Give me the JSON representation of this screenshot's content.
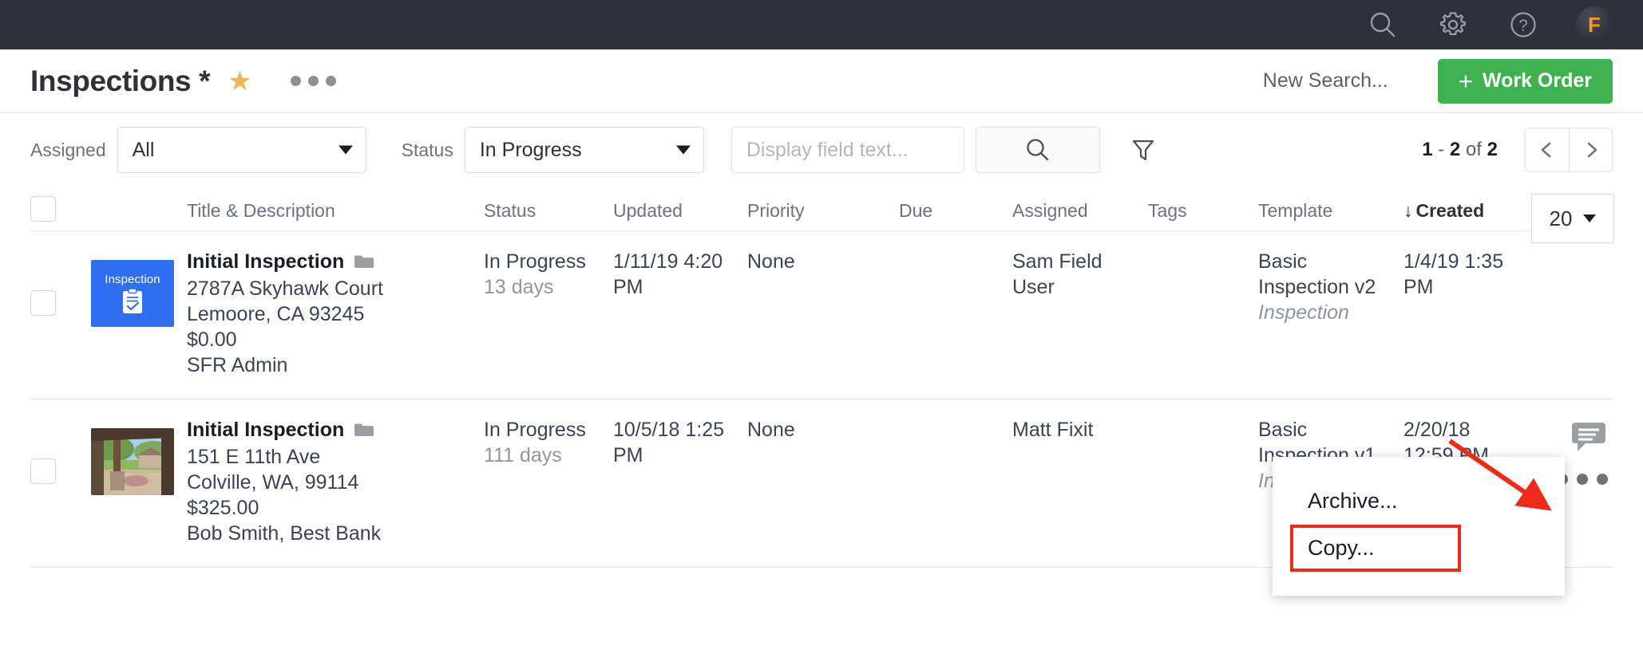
{
  "topbar": {
    "icons": [
      {
        "name": "search-icon",
        "label": "Search"
      },
      {
        "name": "gear-icon",
        "label": "Settings"
      },
      {
        "name": "help-icon",
        "label": "Help"
      }
    ],
    "avatar_initial": "F",
    "background_color": "#2e3139",
    "avatar_text_color": "#f59a23"
  },
  "titlebar": {
    "title": "Inspections *",
    "star_label": "★",
    "more_label": "More options",
    "new_search_label": "New Search...",
    "work_order_label": "Work Order",
    "work_order_plus": "+",
    "work_order_color": "#3fb14e"
  },
  "filters": {
    "assigned_label": "Assigned",
    "assigned_value": "All",
    "status_label": "Status",
    "status_value": "In Progress",
    "search_placeholder": "Display field text...",
    "search_value": "",
    "search_button_label": "Search",
    "funnel_label": "Filter"
  },
  "pagination": {
    "range_start": "1",
    "range_sep": " - ",
    "range_end": "2",
    "of_label": " of ",
    "total": "2",
    "summary": "1 - 2 of 2",
    "prev_label": "‹",
    "next_label": "›"
  },
  "table": {
    "page_size": "20",
    "sort_arrow": "↓",
    "headers": {
      "title": "Title & Description",
      "status": "Status",
      "updated": "Updated",
      "priority": "Priority",
      "due": "Due",
      "assigned": "Assigned",
      "tags": "Tags",
      "template": "Template",
      "created": "Created"
    },
    "rows": [
      {
        "thumb_type": "placeholder",
        "thumb_label": "Inspection",
        "thumb_color": "#2f6ef0",
        "title": "Initial Inspection",
        "address1": "2787A Skyhawk Court",
        "address2": "Lemoore, CA 93245",
        "amount": "$0.00",
        "contact": "SFR Admin",
        "status": "In Progress",
        "status_age": "13 days",
        "updated_date": "1/11/19 4:20",
        "updated_ampm": "PM",
        "priority": "None",
        "due": "",
        "assigned_line1": "Sam Field",
        "assigned_line2": "User",
        "tags": "",
        "template_line1": "Basic",
        "template_line2": "Inspection v2",
        "template_type": "Inspection",
        "created_date": "1/4/19 1:35",
        "created_ampm": "PM",
        "has_comment": false,
        "has_menu": false
      },
      {
        "thumb_type": "photo",
        "thumb_label": "",
        "thumb_color": "",
        "title": "Initial Inspection",
        "address1": "151 E 11th Ave",
        "address2": "Colville, WA, 99114",
        "amount": "$325.00",
        "contact": "Bob Smith, Best Bank",
        "status": "In Progress",
        "status_age": "111 days",
        "updated_date": "10/5/18 1:25",
        "updated_ampm": "PM",
        "priority": "None",
        "due": "",
        "assigned_line1": "Matt Fixit",
        "assigned_line2": "",
        "tags": "",
        "template_line1": "Basic",
        "template_line2": "Inspection v1",
        "template_type": "Inspection",
        "created_date": "2/20/18",
        "created_ampm": "12:59 PM",
        "has_comment": true,
        "has_menu": true
      }
    ]
  },
  "context_menu": {
    "visible": true,
    "items": [
      {
        "label": "Archive...",
        "highlighted": false
      },
      {
        "label": "Copy...",
        "highlighted": true
      }
    ],
    "highlight_color": "#ee2b18"
  },
  "annotation": {
    "arrow_color": "#ee2b18",
    "arrow_target": "row-actions-dots"
  }
}
